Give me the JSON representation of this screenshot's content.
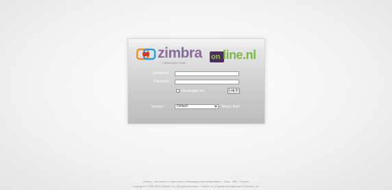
{
  "logo": {
    "zimbra_text": "zimbra",
    "zimbra_tagline": "Collaboration Suite",
    "online_badge": "on",
    "online_text": "line.nl",
    "colors": {
      "zimbra": "#8a6a9c",
      "online": "#7ab648",
      "badge": "#4a2e5e"
    }
  },
  "form": {
    "username_label": "Username:",
    "username_value": "",
    "password_label": "Password:",
    "password_value": "",
    "remember_label": "Remember me",
    "remember_checked": false,
    "login_button": "Log In",
    "version_label": "Version:",
    "version_selected": "Default",
    "help_link": "What's this?"
  },
  "footer": {
    "line1": "Zimbra :: the leader in open source messaging and collaboration :: Blog - Wiki - Forums",
    "line2": "Copyright © 2005-2010 Zimbra, Inc. All rights reserved. \"Zimbra\" is a registered trademark of Zimbra, Inc."
  }
}
